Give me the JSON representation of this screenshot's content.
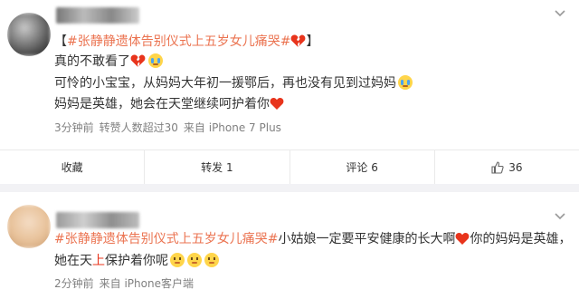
{
  "comments": [
    {
      "username": "",
      "topic_prefix": "【",
      "topic": "#张静静遗体告别仪式上五岁女儿痛哭#",
      "topic_suffix": "】",
      "lines": [
        "真的不敢看了",
        "可怜的小宝宝，从妈妈大年初一援鄂后，再也没有见到过妈妈",
        "妈妈是英雄，她会在天堂继续呵护着你"
      ],
      "time": "3分钟前",
      "likes_text": "转赞人数超过30",
      "source": "来自 iPhone 7 Plus",
      "actions": {
        "favorite": "收藏",
        "repost": "转发 1",
        "comment": "评论 6",
        "like_count": "36"
      }
    },
    {
      "username": "",
      "topic": "#张静静遗体告别仪式上五岁女儿痛哭#",
      "text_after_topic": "小姑娘一定要平安健康的长大啊",
      "text_after_heart": "你的妈妈是英雄，",
      "line2_a": "她在天",
      "line2_red": "上",
      "line2_b": "保护着你呢",
      "time": "2分钟前",
      "source": "来自 iPhone客户端"
    }
  ],
  "colors": {
    "topic": "#eb7350",
    "heart": "#e8341c",
    "meta": "#808080"
  },
  "icons": [
    "chevron-down-icon",
    "broken-heart-icon",
    "crying-face-icon",
    "red-heart-icon",
    "thumb-up-icon",
    "awkward-face-icon"
  ]
}
